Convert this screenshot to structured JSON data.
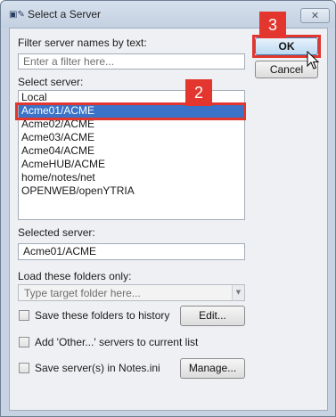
{
  "window": {
    "title": "Select a Server",
    "close_glyph": "✕",
    "icon": "document-icon"
  },
  "filter": {
    "label": "Filter server names by text:",
    "placeholder": "Enter a filter here..."
  },
  "server_list": {
    "label": "Select server:",
    "items": [
      "Local",
      "Acme01/ACME",
      "Acme02/ACME",
      "Acme03/ACME",
      "Acme04/ACME",
      "AcmeHUB/ACME",
      "home/notes/net",
      "OPENWEB/openYTRIA"
    ],
    "selected_index": 1
  },
  "selected_server": {
    "label": "Selected server:",
    "value": "Acme01/ACME"
  },
  "folders": {
    "label": "Load these folders only:",
    "placeholder": "Type target folder here..."
  },
  "options": {
    "save_history": "Save these folders to history",
    "edit_button": "Edit...",
    "add_other": "Add 'Other...' servers to current list",
    "save_notes_ini": "Save server(s) in Notes.ini",
    "manage_button": "Manage..."
  },
  "buttons": {
    "ok": "OK",
    "cancel": "Cancel"
  },
  "annotations": {
    "step_list": "2",
    "step_ok": "3",
    "highlight_color": "#e2362f"
  }
}
